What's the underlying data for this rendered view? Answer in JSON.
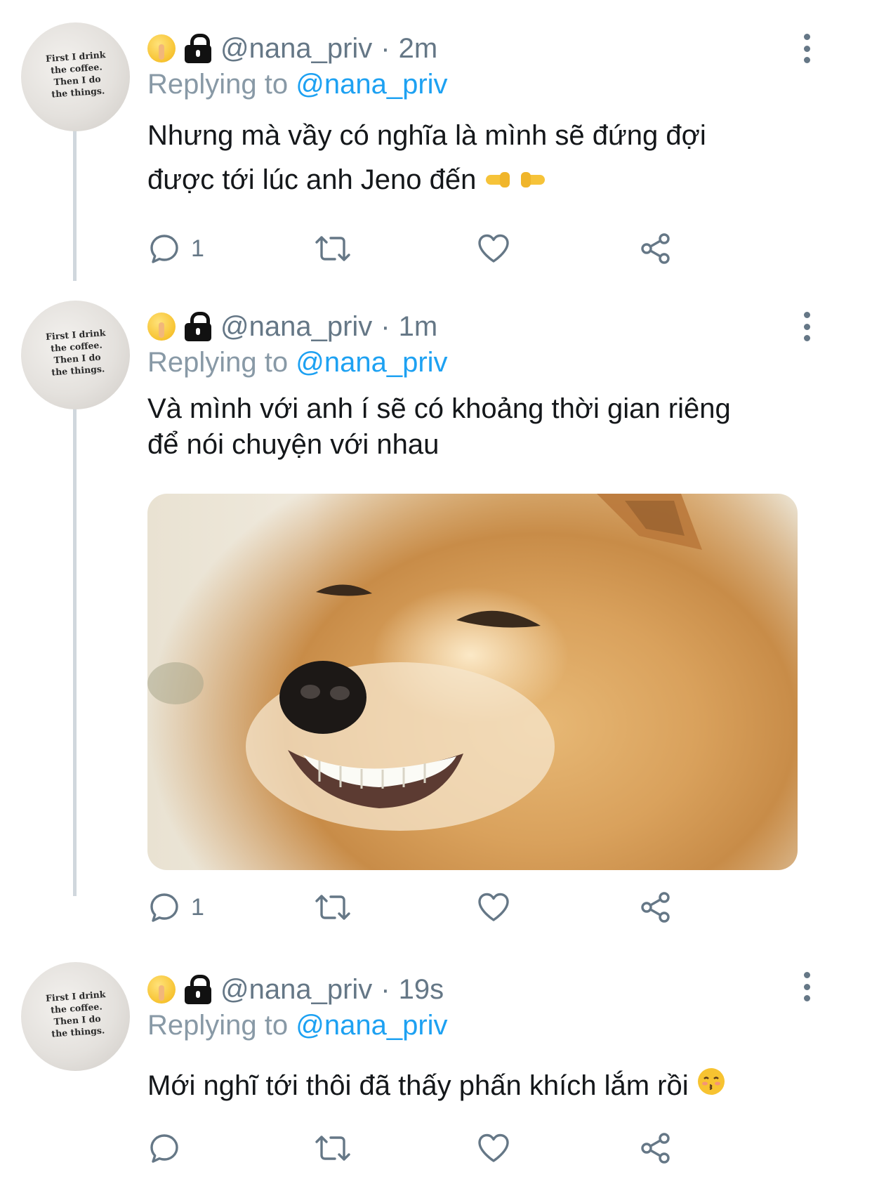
{
  "avatar_text": "First I drink\nthe coffee.\nThen I do\nthe things.",
  "replying_prefix": "Replying to",
  "tweets": [
    {
      "handle": "@nana_priv",
      "separator": "·",
      "time": "2m",
      "reply_to": "@nana_priv",
      "text_lines": [
        "Nhưng mà vầy có nghĩa là mình sẽ đứng đợi",
        "được tới lúc anh Jeno đến"
      ],
      "trailing_emoji": "pointing-fingers",
      "reply_count": "1",
      "has_media": false
    },
    {
      "handle": "@nana_priv",
      "separator": "·",
      "time": "1m",
      "reply_to": "@nana_priv",
      "text_lines": [
        "Và mình với anh í sẽ có khoảng thời gian riêng",
        "để nói chuyện với nhau"
      ],
      "reply_count": "1",
      "has_media": true,
      "media_icon": "smirking-shiba-dog-photo"
    },
    {
      "handle": "@nana_priv",
      "separator": "·",
      "time": "19s",
      "reply_to": "@nana_priv",
      "text_lines": [
        "Mới nghĩ tới thôi đã thấy phấn khích lắm rồi"
      ],
      "trailing_emoji": "kissing-face",
      "reply_count": "",
      "has_media": false
    }
  ],
  "colors": {
    "mention": "#1da1f2",
    "muted": "#657786",
    "thread_line": "#d0d7dd"
  },
  "icons": [
    "shushing-face-icon",
    "lock-icon",
    "reply-icon",
    "retweet-icon",
    "like-icon",
    "share-icon",
    "more-options-icon"
  ]
}
